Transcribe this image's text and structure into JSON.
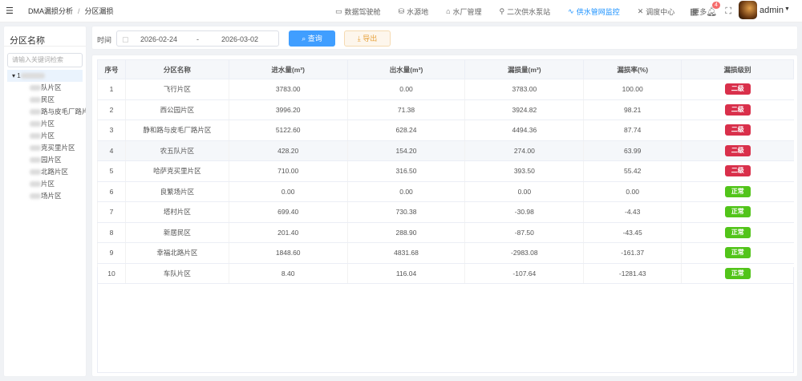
{
  "header": {
    "breadcrumb": [
      "DMA漏损分析",
      "分区漏损"
    ],
    "breadcrumb_sep": "/",
    "nav": [
      {
        "label": "数据驾驶舱",
        "icon": "monitor-icon"
      },
      {
        "label": "水源地",
        "icon": "water-source-icon"
      },
      {
        "label": "水厂管理",
        "icon": "home-icon"
      },
      {
        "label": "二次供水泵站",
        "icon": "pump-icon"
      },
      {
        "label": "供水管网监控",
        "icon": "pipe-icon",
        "active": true
      },
      {
        "label": "调度中心",
        "icon": "tools-icon"
      },
      {
        "label": "更多",
        "icon": "chevron-down-icon"
      }
    ],
    "notification_count": "4",
    "user": "admin"
  },
  "sidebar": {
    "title": "分区名称",
    "search_placeholder": "请输入关键词检索",
    "root": "1",
    "items": [
      "队片区",
      "民区",
      "路与皮毛厂路片",
      "片区",
      "片区",
      "克买里片区",
      "园片区",
      "北路片区",
      "片区",
      "场片区"
    ]
  },
  "toolbar": {
    "time_label": "时间",
    "start": "2026-02-24",
    "sep": "-",
    "end": "2026-03-02",
    "query": "查询",
    "export": "导出"
  },
  "colors": {
    "primary": "#409eff",
    "level2": "#d9304b",
    "normal": "#52c41a"
  },
  "table": {
    "columns": [
      "序号",
      "分区名称",
      "进水量(m³)",
      "出水量(m³)",
      "漏损量(m³)",
      "漏损率(%)",
      "漏损级别"
    ],
    "rows": [
      [
        "1",
        "飞行片区",
        "3783.00",
        "0.00",
        "3783.00",
        "100.00",
        "二级"
      ],
      [
        "2",
        "西公园片区",
        "3996.20",
        "71.38",
        "3924.82",
        "98.21",
        "二级"
      ],
      [
        "3",
        "静和路与皮毛厂路片区",
        "5122.60",
        "628.24",
        "4494.36",
        "87.74",
        "二级"
      ],
      [
        "4",
        "农五队片区",
        "428.20",
        "154.20",
        "274.00",
        "63.99",
        "二级"
      ],
      [
        "5",
        "哈萨克买里片区",
        "710.00",
        "316.50",
        "393.50",
        "55.42",
        "二级"
      ],
      [
        "6",
        "良繁场片区",
        "0.00",
        "0.00",
        "0.00",
        "0.00",
        "正常"
      ],
      [
        "7",
        "塔村片区",
        "699.40",
        "730.38",
        "-30.98",
        "-4.43",
        "正常"
      ],
      [
        "8",
        "新居民区",
        "201.40",
        "288.90",
        "-87.50",
        "-43.45",
        "正常"
      ],
      [
        "9",
        "幸福北路片区",
        "1848.60",
        "4831.68",
        "-2983.08",
        "-161.37",
        "正常"
      ],
      [
        "10",
        "车队片区",
        "8.40",
        "116.04",
        "-107.64",
        "-1281.43",
        "正常"
      ]
    ]
  }
}
